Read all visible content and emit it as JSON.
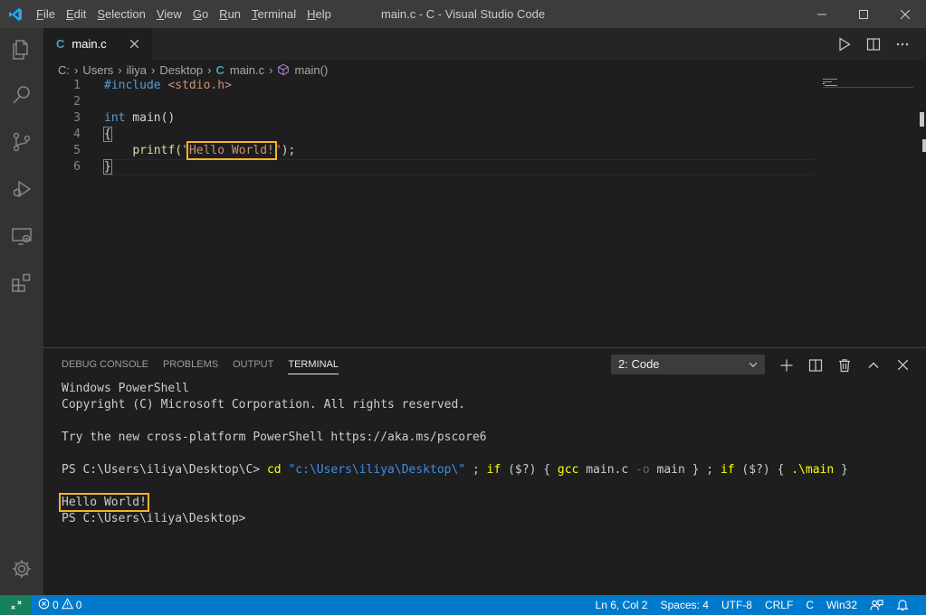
{
  "window": {
    "title": "main.c - C - Visual Studio Code"
  },
  "menubar": {
    "items": [
      {
        "key": "F",
        "rest": "ile"
      },
      {
        "key": "E",
        "rest": "dit"
      },
      {
        "key": "S",
        "rest": "election"
      },
      {
        "key": "V",
        "rest": "iew"
      },
      {
        "key": "G",
        "rest": "o"
      },
      {
        "key": "R",
        "rest": "un"
      },
      {
        "key": "T",
        "rest": "erminal"
      },
      {
        "key": "H",
        "rest": "elp"
      }
    ]
  },
  "tab": {
    "icon": "C",
    "label": "main.c"
  },
  "breadcrumbs": {
    "parts": [
      "C:",
      "Users",
      "iliya",
      "Desktop"
    ],
    "file_icon": "C",
    "file": "main.c",
    "symbol": "main()"
  },
  "code": {
    "line_numbers": [
      "1",
      "2",
      "3",
      "4",
      "5",
      "6"
    ],
    "include_directive": "#include",
    "include_header": "<stdio.h>",
    "type_kw": "int",
    "fn_decl": " main()",
    "open_brace": "{",
    "indent": "    ",
    "printf": "printf(",
    "quote": "\"",
    "hello": "Hello World!",
    "printf_end": ");",
    "close_brace": "}"
  },
  "panel": {
    "tabs": [
      "DEBUG CONSOLE",
      "PROBLEMS",
      "OUTPUT",
      "TERMINAL"
    ],
    "active_tab": "TERMINAL",
    "terminal_selected": "2: Code"
  },
  "terminal": {
    "line1": "Windows PowerShell",
    "line2": "Copyright (C) Microsoft Corporation. All rights reserved.",
    "line4": "Try the new cross-platform PowerShell https://aka.ms/pscore6",
    "prompt1": "PS C:\\Users\\iliya\\Desktop\\C> ",
    "cmd_cd": "cd",
    "cmd_path": "\"c:\\Users\\iliya\\Desktop\\\"",
    "cmd_sep1": " ; ",
    "cmd_if1": "if",
    "cmd_cond1": " ($?) { ",
    "cmd_gcc": "gcc",
    "cmd_args": " main.c ",
    "cmd_o": "-o",
    "cmd_main": " main } ; ",
    "cmd_if2": "if",
    "cmd_cond2": " ($?) { ",
    "cmd_run": ".\\main",
    "cmd_end": " }",
    "output": "Hello World!",
    "prompt2": "PS C:\\Users\\iliya\\Desktop>"
  },
  "statusbar": {
    "errors": "0",
    "warnings": "0",
    "position": "Ln 6, Col 2",
    "spaces": "Spaces: 4",
    "encoding": "UTF-8",
    "eol": "CRLF",
    "language": "C",
    "config": "Win32"
  },
  "colors": {
    "titlebar": "#3c3c3c",
    "activitybar": "#333333",
    "editor_bg": "#1e1e1e",
    "statusbar": "#007acc",
    "highlight_box": "#f5b42a"
  }
}
